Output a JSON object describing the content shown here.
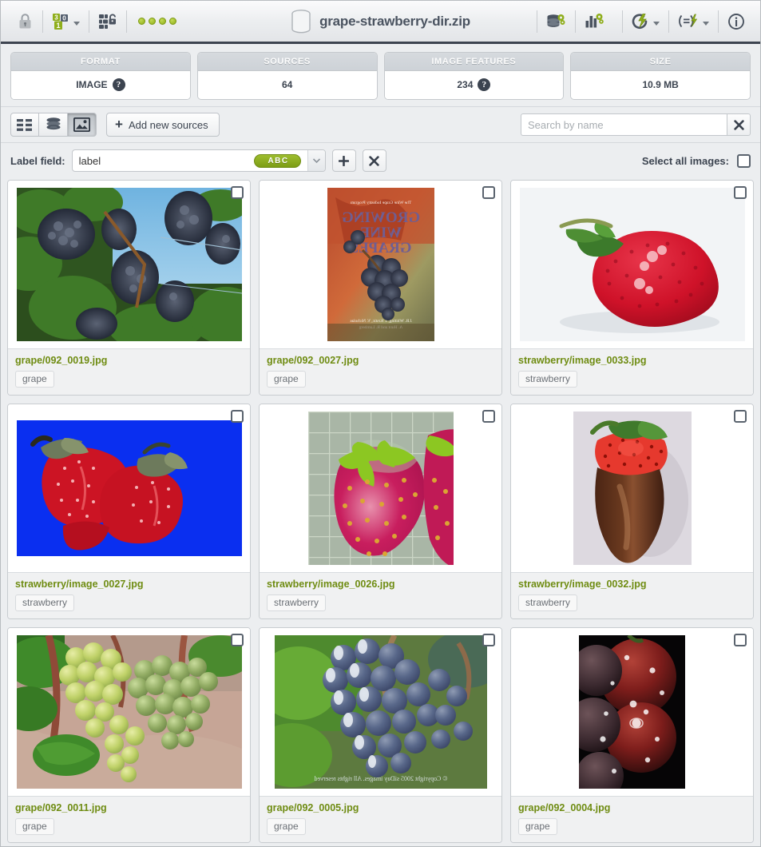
{
  "window": {
    "title": "grape-strawberry-dir.zip",
    "title_icon": "database-icon"
  },
  "toolbar": {
    "left": [
      {
        "name": "lock-icon",
        "label": "Lock",
        "has_caret": false
      },
      {
        "name": "data-types-icon",
        "label": "Data types",
        "has_caret": true
      },
      {
        "name": "feature-matrix-icon",
        "label": "Feature matrix",
        "has_caret": false
      },
      {
        "name": "status-dots-icon",
        "label": "Status",
        "has_caret": false
      }
    ],
    "right": [
      {
        "name": "database-settings-icon",
        "label": "Data settings",
        "has_caret": false
      },
      {
        "name": "chart-settings-icon",
        "label": "Chart settings",
        "has_caret": false
      },
      {
        "name": "quick-actions-icon",
        "label": "Quick actions",
        "has_caret": true
      },
      {
        "name": "formula-run-icon",
        "label": "Run script",
        "has_caret": true
      },
      {
        "name": "info-icon",
        "label": "Info",
        "has_caret": false
      }
    ],
    "status_dot_count": 4
  },
  "stats": [
    {
      "header": "FORMAT",
      "value": "IMAGE",
      "has_help": true
    },
    {
      "header": "SOURCES",
      "value": "64",
      "has_help": false
    },
    {
      "header": "IMAGE FEATURES",
      "value": "234",
      "has_help": true
    },
    {
      "header": "SIZE",
      "value": "10.9 MB",
      "has_help": false
    }
  ],
  "viewbar": {
    "views": [
      {
        "name": "list-view",
        "icon": "list-icon",
        "active": false
      },
      {
        "name": "sources-view",
        "icon": "database-icon",
        "active": false
      },
      {
        "name": "image-view",
        "icon": "image-icon",
        "active": true
      }
    ],
    "add_sources_label": "Add new sources",
    "add_sources_icon": "plus-icon",
    "search_placeholder": "Search by name",
    "search_value": "",
    "search_clear_icon": "close-icon"
  },
  "labelbar": {
    "label": "Label field:",
    "field_value": "label",
    "field_badge": "ABC",
    "add_icon": "plus-icon",
    "remove_icon": "close-icon",
    "select_all_label": "Select all images:",
    "select_all_checked": false
  },
  "colors": {
    "accent_green": "#7d9d15",
    "filename_green": "#6f8c12",
    "dark_slate": "#3c4450",
    "titlebar_underline": "#3d4450"
  },
  "gallery": {
    "items": [
      {
        "filename": "grape/092_0019.jpg",
        "tag": "grape",
        "checked": false,
        "art": "grapes-vineyard"
      },
      {
        "filename": "grape/092_0027.jpg",
        "tag": "grape",
        "checked": false,
        "art": "book-cover"
      },
      {
        "filename": "strawberry/image_0033.jpg",
        "tag": "strawberry",
        "checked": false,
        "art": "strawberry-white"
      },
      {
        "filename": "strawberry/image_0027.jpg",
        "tag": "strawberry",
        "checked": false,
        "art": "strawberry-blue"
      },
      {
        "filename": "strawberry/image_0026.jpg",
        "tag": "strawberry",
        "checked": false,
        "art": "strawberry-grid"
      },
      {
        "filename": "strawberry/image_0032.jpg",
        "tag": "strawberry",
        "checked": false,
        "art": "strawberry-chocolate"
      },
      {
        "filename": "grape/092_0011.jpg",
        "tag": "grape",
        "checked": false,
        "art": "green-grapes"
      },
      {
        "filename": "grape/092_0005.jpg",
        "tag": "grape",
        "checked": false,
        "art": "blue-grapes"
      },
      {
        "filename": "grape/092_0004.jpg",
        "tag": "grape",
        "checked": false,
        "art": "grape-dark"
      }
    ]
  }
}
